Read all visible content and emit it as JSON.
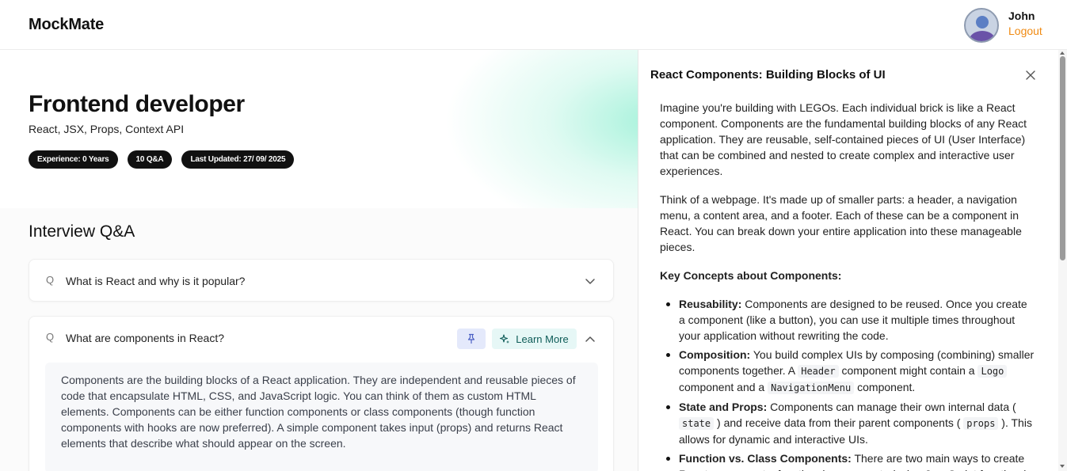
{
  "header": {
    "logo": "MockMate",
    "user_name": "John",
    "logout_label": "Logout"
  },
  "session": {
    "role": "Frontend developer",
    "topics": "React, JSX, Props, Context API",
    "badges": [
      "Experience: 0 Years",
      "10 Q&A",
      "Last Updated: 27/ 09/ 2025"
    ]
  },
  "qa": {
    "title": "Interview Q&A",
    "q_mark": "Q",
    "items": [
      {
        "question": "What is React and why is it popular?"
      },
      {
        "question": "What are components in React?",
        "learn_more_label": "Learn More",
        "answer": "Components are the building blocks of a React application. They are independent and reusable pieces of code that encapsulate HTML, CSS, and JavaScript logic. You can think of them as custom HTML elements. Components can be either function components or class components (though function components with hooks are now preferred). A simple component takes input (props) and returns React elements that describe what should appear on the screen."
      }
    ]
  },
  "drawer": {
    "title": "React Components: Building Blocks of UI",
    "p1": "Imagine you're building with LEGOs. Each individual brick is like a React component. Components are the fundamental building blocks of any React application. They are reusable, self-contained pieces of UI (User Interface) that can be combined and nested to create complex and interactive user experiences.",
    "p2": "Think of a webpage. It's made up of smaller parts: a header, a navigation menu, a content area, and a footer. Each of these can be a component in React. You can break down your entire application into these manageable pieces.",
    "key_heading": "Key Concepts about Components:",
    "b1_term": "Reusability:",
    "b1_text": " Components are designed to be reused. Once you create a component (like a button), you can use it multiple times throughout your application without rewriting the code.",
    "b2_term": "Composition:",
    "b2_t1": " You build complex UIs by composing (combining) smaller components together. A ",
    "b2_c1": "Header",
    "b2_t2": " component might contain a ",
    "b2_c2": "Logo",
    "b2_t3": " component and a ",
    "b2_c3": "NavigationMenu",
    "b2_t4": " component.",
    "b3_term": "State and Props:",
    "b3_t1": " Components can manage their own internal data ( ",
    "b3_c1": "state",
    "b3_t2": " ) and receive data from their parent components ( ",
    "b3_c2": "props",
    "b3_t3": " ). This allows for dynamic and interactive UIs.",
    "b4_term": "Function vs. Class Components:",
    "b4_text": " There are two main ways to create React components: functional components (using JavaScript functions)"
  }
}
